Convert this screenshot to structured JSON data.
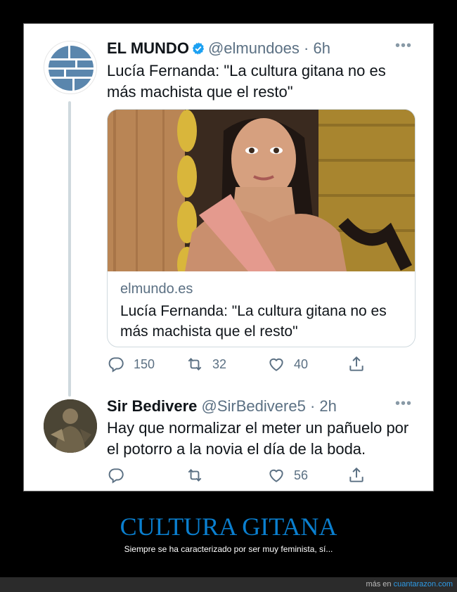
{
  "tweet1": {
    "name": "EL MUNDO",
    "handle": "@elmundoes",
    "time": "6h",
    "text": "Lucía Fernanda: \"La cultura gitana no es más machista que el resto\"",
    "card": {
      "domain": "elmundo.es",
      "title": "Lucía Fernanda: \"La cultura gitana no es más machista que el resto\""
    },
    "replies": "150",
    "retweets": "32",
    "likes": "40"
  },
  "tweet2": {
    "name": "Sir Bedivere",
    "handle": "@SirBedivere5",
    "time": "2h",
    "text": "Hay que normalizar el meter un pañuelo por el potorro a la novia el día de la boda.",
    "replies": "",
    "retweets": "",
    "likes": "56"
  },
  "caption": {
    "title": "CULTURA GITANA",
    "subtitle": "Siempre se ha caracterizado por ser muy feminista, sí..."
  },
  "footer": {
    "prefix": "más en",
    "link": "cuantarazon.com"
  },
  "colors": {
    "accent": "#1da1f2",
    "caption_title": "#0a7fcf",
    "logo_blue": "#5a86ad",
    "muted": "#5b7083"
  },
  "icons": [
    "verified-icon",
    "more-icon",
    "reply-icon",
    "retweet-icon",
    "like-icon",
    "share-icon"
  ]
}
